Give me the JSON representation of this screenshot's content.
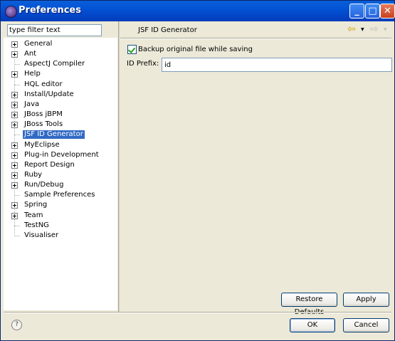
{
  "window": {
    "title": "Preferences",
    "controls": {
      "minimize": "_",
      "maximize": "□",
      "close": "✕"
    }
  },
  "filter": {
    "value": "type filter text"
  },
  "tree": {
    "items": [
      {
        "label": "General",
        "expandable": true
      },
      {
        "label": "Ant",
        "expandable": true
      },
      {
        "label": "AspectJ Compiler",
        "expandable": false
      },
      {
        "label": "Help",
        "expandable": true
      },
      {
        "label": "HQL editor",
        "expandable": false
      },
      {
        "label": "Install/Update",
        "expandable": true
      },
      {
        "label": "Java",
        "expandable": true
      },
      {
        "label": "JBoss jBPM",
        "expandable": true
      },
      {
        "label": "JBoss Tools",
        "expandable": true
      },
      {
        "label": "JSF ID Generator",
        "expandable": false,
        "selected": true
      },
      {
        "label": "MyEclipse",
        "expandable": true
      },
      {
        "label": "Plug-in Development",
        "expandable": true
      },
      {
        "label": "Report Design",
        "expandable": true
      },
      {
        "label": "Ruby",
        "expandable": true
      },
      {
        "label": "Run/Debug",
        "expandable": true
      },
      {
        "label": "Sample Preferences",
        "expandable": false
      },
      {
        "label": "Spring",
        "expandable": true
      },
      {
        "label": "Team",
        "expandable": true
      },
      {
        "label": "TestNG",
        "expandable": false
      },
      {
        "label": "Visualiser",
        "expandable": false
      }
    ]
  },
  "page": {
    "title": "JSF ID Generator",
    "backup_checkbox": {
      "label": "Backup original file while saving",
      "checked": true
    },
    "prefix": {
      "label": "ID Prefix:",
      "value": "id"
    }
  },
  "nav": {
    "back_icon": "back-arrow-icon",
    "forward_icon": "forward-arrow-icon"
  },
  "buttons": {
    "restore_defaults": "Restore Defaults",
    "apply": "Apply",
    "ok": "OK",
    "cancel": "Cancel"
  },
  "help": {
    "glyph": "?"
  }
}
